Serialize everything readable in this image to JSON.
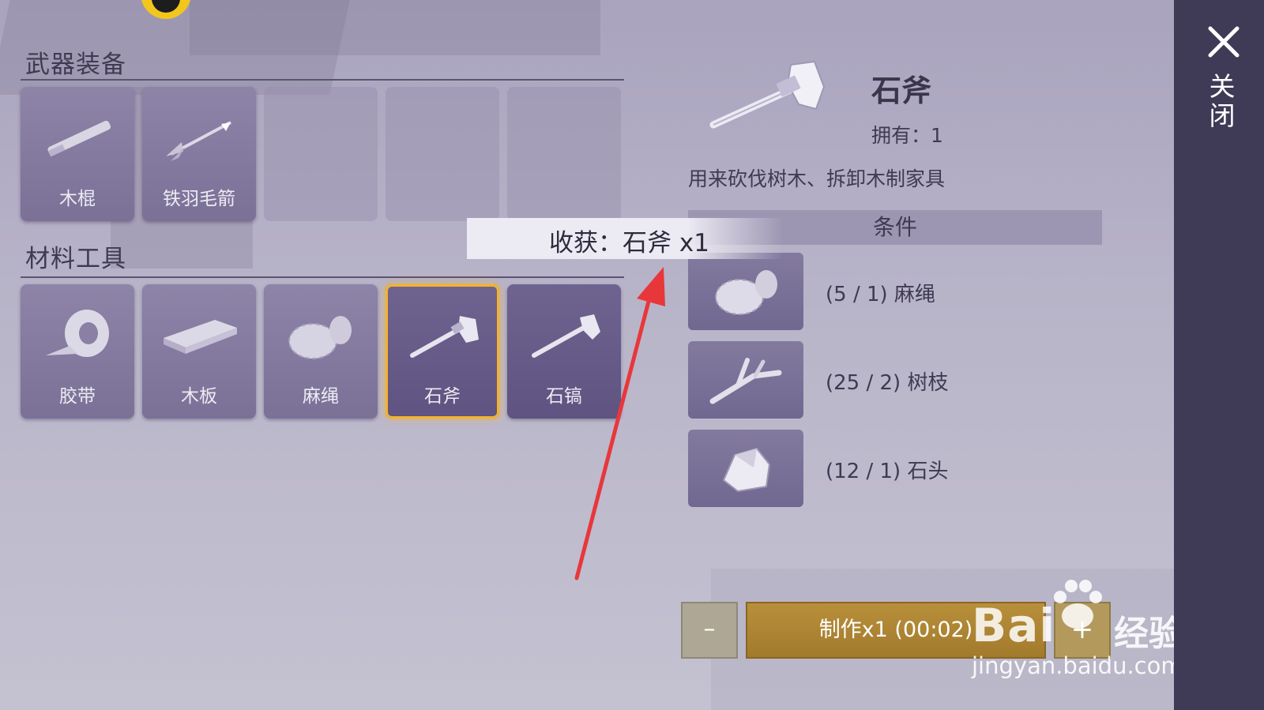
{
  "sections": {
    "weapons": {
      "title": "武器装备",
      "items": [
        {
          "label": "木棍",
          "icon": "wooden-stick-icon"
        },
        {
          "label": "铁羽毛箭",
          "icon": "iron-feather-arrow-icon"
        },
        {
          "label": "",
          "icon": ""
        },
        {
          "label": "",
          "icon": ""
        },
        {
          "label": "",
          "icon": ""
        }
      ]
    },
    "materials": {
      "title": "材料工具",
      "items": [
        {
          "label": "胶带",
          "icon": "tape-icon"
        },
        {
          "label": "木板",
          "icon": "plank-icon"
        },
        {
          "label": "麻绳",
          "icon": "rope-icon"
        },
        {
          "label": "石斧",
          "icon": "stone-axe-icon",
          "selected": true
        },
        {
          "label": "石镐",
          "icon": "stone-pickaxe-icon"
        }
      ]
    }
  },
  "detail": {
    "name": "石斧",
    "owned": "拥有：1",
    "description": "用来砍伐树木、拆卸木制家具",
    "conditions_title": "条件",
    "requirements": [
      {
        "text": "(5 / 1) 麻绳",
        "icon": "rope-icon"
      },
      {
        "text": "(25 / 2) 树枝",
        "icon": "branch-icon"
      },
      {
        "text": "(12 / 1) 石头",
        "icon": "stone-icon"
      }
    ]
  },
  "toast": {
    "text": "收获：石斧 x1"
  },
  "craft": {
    "minus": "–",
    "make_label": "制作x1 (00:02)",
    "plus": "+"
  },
  "close": {
    "label": "关闭"
  },
  "watermark": {
    "brand": "Bai",
    "cn": "经验",
    "url": "jingyan.baidu.com"
  },
  "colors": {
    "panel": "#3f3a55",
    "selected_outline": "#f4b32a",
    "craft_button": "#b8903b",
    "arrow": "#e8373b"
  }
}
